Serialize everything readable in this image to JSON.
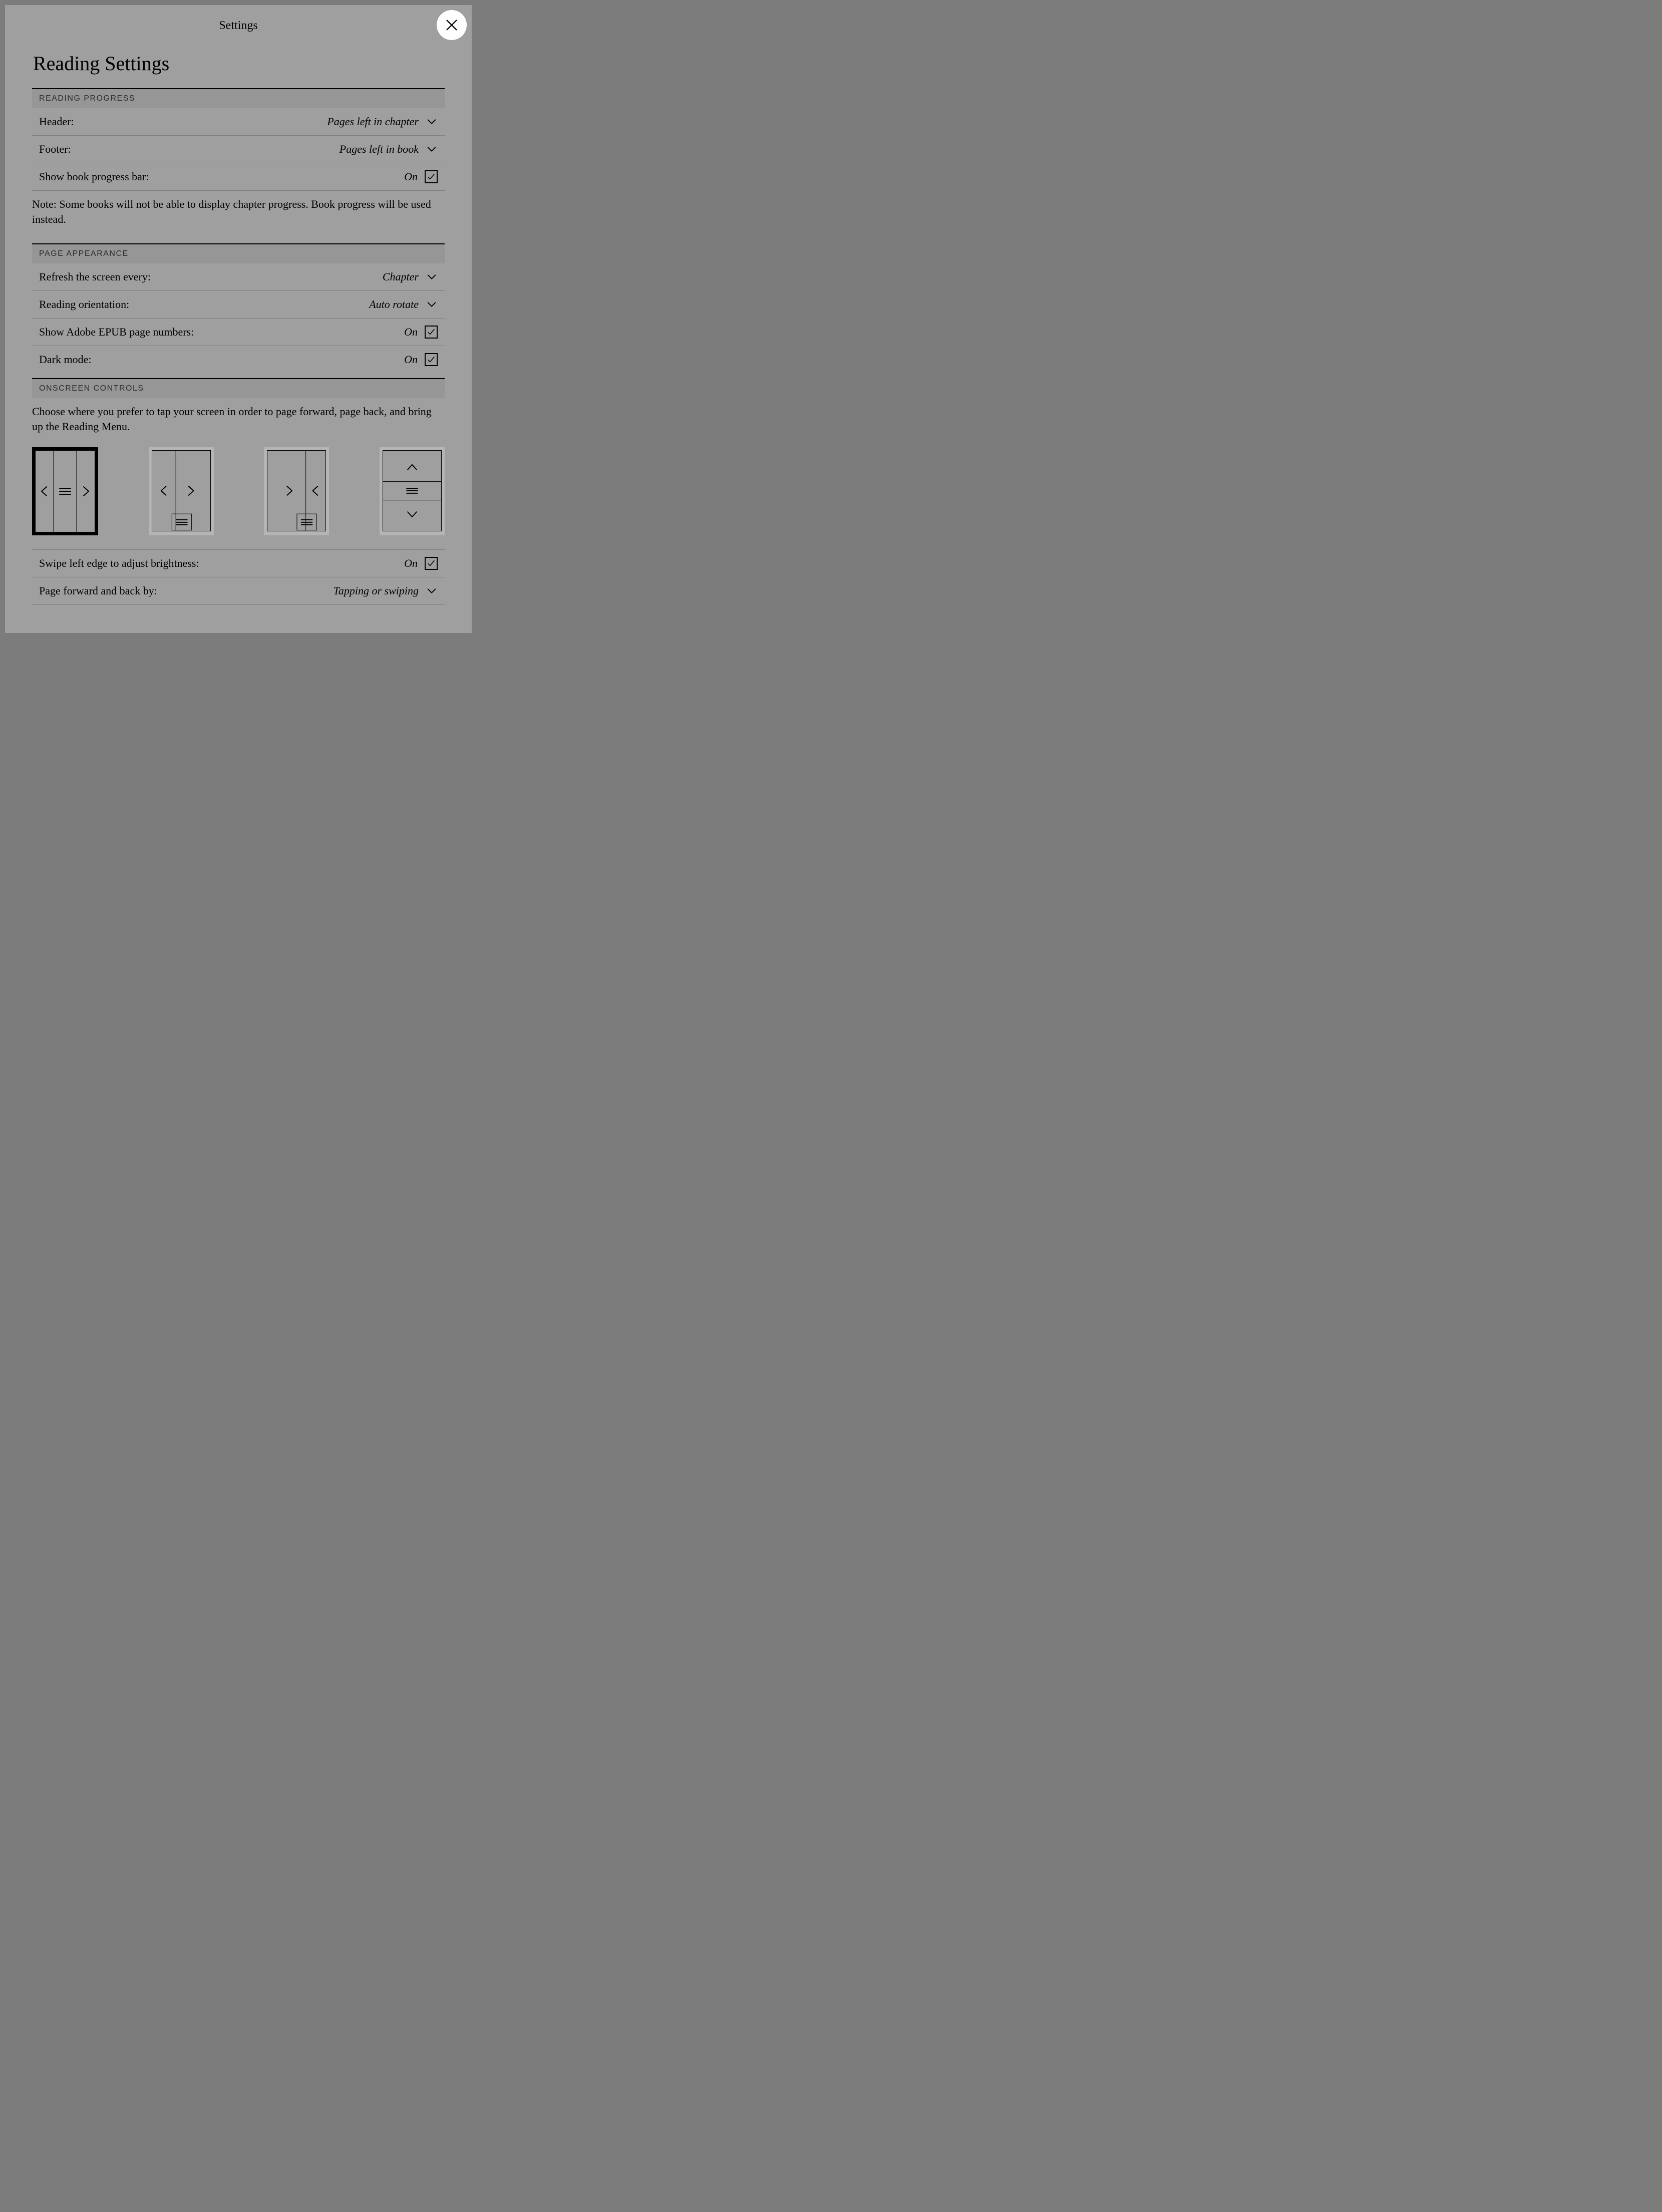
{
  "modal_title": "Settings",
  "page_title": "Reading Settings",
  "sections": {
    "reading_progress": {
      "title": "READING PROGRESS",
      "header": {
        "label": "Header:",
        "value": "Pages left in chapter"
      },
      "footer": {
        "label": "Footer:",
        "value": "Pages left in book"
      },
      "progress_bar": {
        "label": "Show book progress bar:",
        "value": "On"
      },
      "note": "Note: Some books will not be able to display chapter progress. Book progress will be used instead."
    },
    "page_appearance": {
      "title": "PAGE APPEARANCE",
      "refresh": {
        "label": "Refresh the screen every:",
        "value": "Chapter"
      },
      "orientation": {
        "label": "Reading orientation:",
        "value": "Auto rotate"
      },
      "adobe": {
        "label": "Show Adobe EPUB page numbers:",
        "value": "On"
      },
      "dark_mode": {
        "label": "Dark mode:",
        "value": "On"
      }
    },
    "onscreen_controls": {
      "title": "ONSCREEN CONTROLS",
      "desc": "Choose where you prefer to tap your screen in order to page forward, page back, and bring up the Reading Menu.",
      "swipe_brightness": {
        "label": "Swipe left edge to adjust brightness:",
        "value": "On"
      },
      "page_method": {
        "label": "Page forward and back by:",
        "value": "Tapping or swiping"
      },
      "selected_layout": 0
    }
  }
}
